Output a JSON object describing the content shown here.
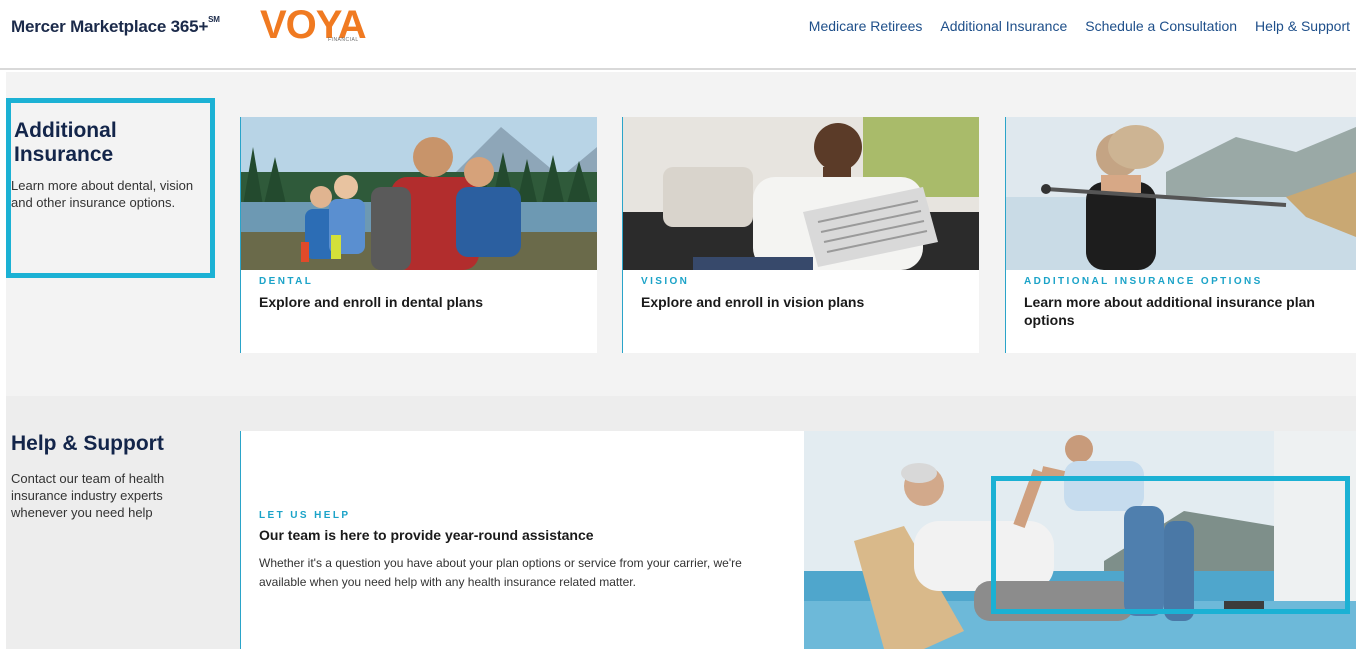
{
  "header": {
    "brand": "Mercer Marketplace 365+",
    "brand_mark": "SM",
    "partner_logo": "VOYA",
    "partner_logo_sub": "FINANCIAL",
    "nav": [
      {
        "label": "Medicare Retirees"
      },
      {
        "label": "Additional Insurance"
      },
      {
        "label": "Schedule a Consultation"
      },
      {
        "label": "Help & Support"
      }
    ]
  },
  "additional": {
    "title": "Additional Insurance",
    "description": "Learn more about dental, vision and other insurance options.",
    "cards": [
      {
        "eyebrow": "DENTAL",
        "title": "Explore and enroll in dental plans",
        "image": "family-lake-photo"
      },
      {
        "eyebrow": "VISION",
        "title": "Explore and enroll in vision plans",
        "image": "man-newspaper-photo"
      },
      {
        "eyebrow": "ADDITIONAL INSURANCE OPTIONS",
        "title": "Learn more about additional insurance plan options",
        "image": "woman-paddle-photo"
      }
    ]
  },
  "help": {
    "title": "Help & Support",
    "description": "Contact our team of health insurance industry experts whenever you need help",
    "panel": {
      "eyebrow": "LET US HELP",
      "title": "Our team is here to provide year-round assistance",
      "text": "Whether it's a question you have about your plan options or service from your carrier, we're available when you need help with any health insurance related matter."
    },
    "image": "grandfather-child-highfive-photo"
  },
  "colors": {
    "accent": "#1bb1d4",
    "navy": "#13254a",
    "link": "#1e4f8a",
    "voya_orange": "#f07a21"
  }
}
